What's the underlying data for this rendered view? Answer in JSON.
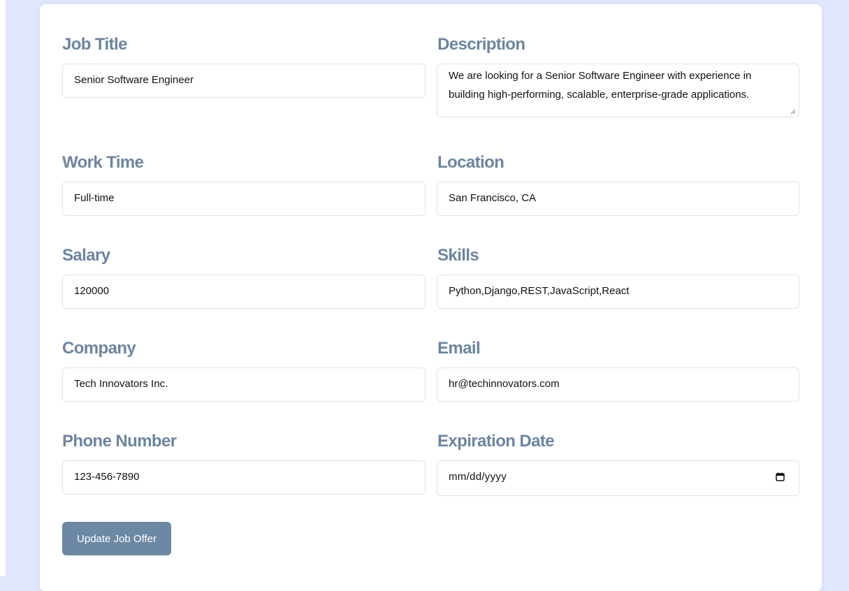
{
  "form": {
    "job_title": {
      "label": "Job Title",
      "value": "Senior Software Engineer"
    },
    "description": {
      "label": "Description",
      "value": "We are looking for a Senior Software Engineer with experience in building high-performing, scalable, enterprise-grade applications."
    },
    "work_time": {
      "label": "Work Time",
      "value": "Full-time"
    },
    "location": {
      "label": "Location",
      "value": "San Francisco, CA"
    },
    "salary": {
      "label": "Salary",
      "value": "120000"
    },
    "skills": {
      "label": "Skills",
      "value": "Python,Django,REST,JavaScript,React"
    },
    "company": {
      "label": "Company",
      "value": "Tech Innovators Inc."
    },
    "email": {
      "label": "Email",
      "value": "hr@techinnovators.com"
    },
    "phone": {
      "label": "Phone Number",
      "value": "123-456-7890"
    },
    "expiration_date": {
      "label": "Expiration Date",
      "placeholder": "mm/dd/yyyy",
      "icon": "calendar-icon"
    },
    "submit_label": "Update Job Offer"
  },
  "colors": {
    "page_background": "#dfe6fd",
    "label": "#6c85a1",
    "button": "#6c88a4",
    "field_border": "#dfe3ea"
  }
}
